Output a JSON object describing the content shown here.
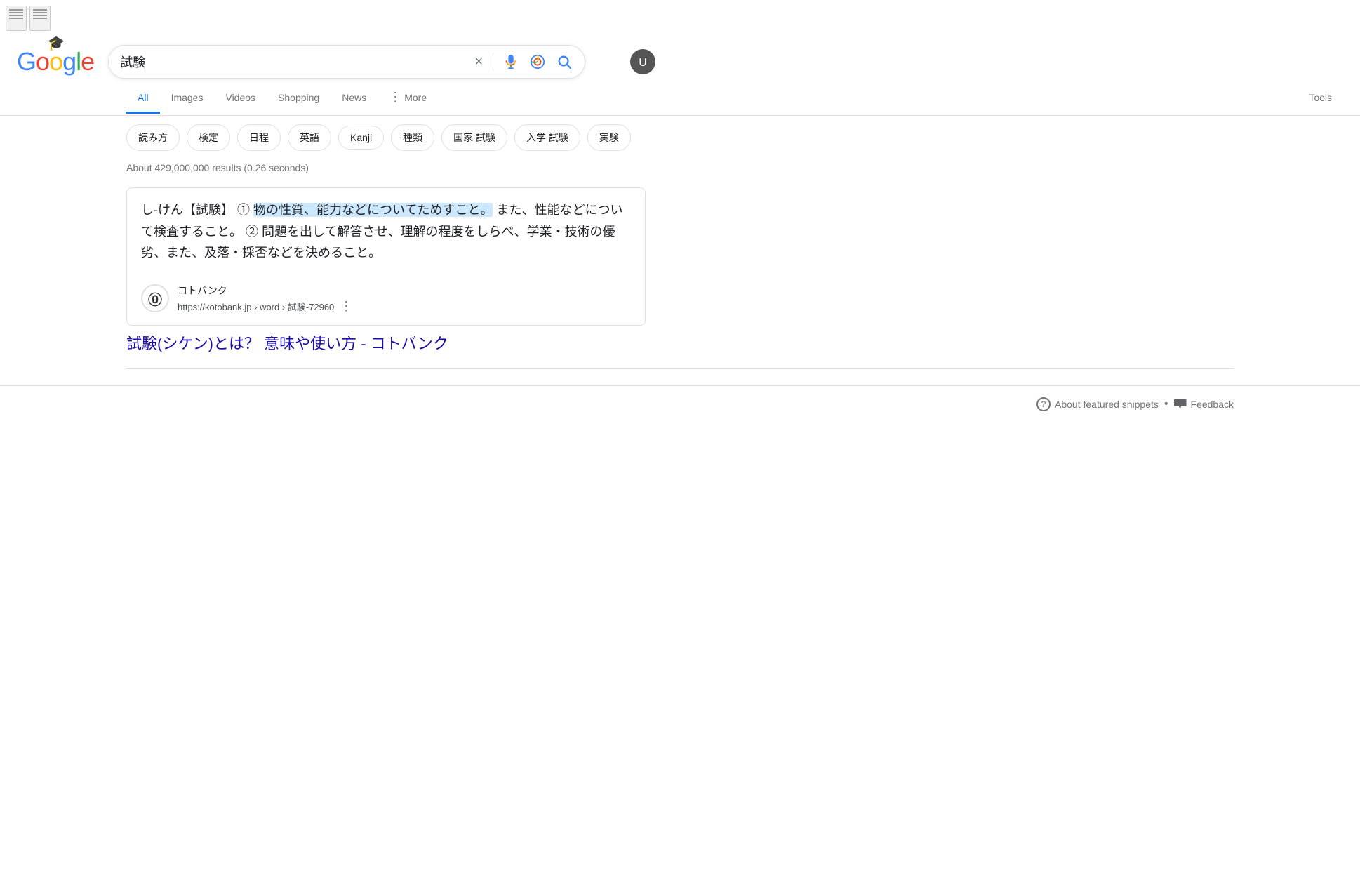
{
  "header": {
    "logo": "Google",
    "search_query": "試験",
    "clear_label": "×",
    "search_button_label": "🔍"
  },
  "nav": {
    "tabs": [
      {
        "id": "all",
        "label": "All",
        "active": true
      },
      {
        "id": "images",
        "label": "Images",
        "active": false
      },
      {
        "id": "videos",
        "label": "Videos",
        "active": false
      },
      {
        "id": "shopping",
        "label": "Shopping",
        "active": false
      },
      {
        "id": "news",
        "label": "News",
        "active": false
      },
      {
        "id": "more",
        "label": "More",
        "active": false,
        "has_dots": true
      },
      {
        "id": "tools",
        "label": "Tools",
        "active": false
      }
    ]
  },
  "chips": {
    "items": [
      {
        "id": "yomikata",
        "label": "読み方"
      },
      {
        "id": "kentei",
        "label": "検定"
      },
      {
        "id": "nittei",
        "label": "日程"
      },
      {
        "id": "eigo",
        "label": "英語"
      },
      {
        "id": "kanji",
        "label": "Kanji"
      },
      {
        "id": "shurui",
        "label": "種類"
      },
      {
        "id": "kokka",
        "label": "国家 試験"
      },
      {
        "id": "nyuugaku",
        "label": "入学 試験"
      },
      {
        "id": "jikken",
        "label": "実験"
      }
    ]
  },
  "results": {
    "count_text": "About 429,000,000 results (0.26 seconds)",
    "featured_snippet": {
      "text_before_highlight": "し‐けん【試験】 ① ",
      "text_highlight": "物の性質、能力などについてためすこと。",
      "text_after": " また、性能などについて検査すること。 ② 問題を出して解答させ、理解の程度をしらべ、学業・技術の優劣、また、及落・採否などを決めること。",
      "source_name": "コトバンク",
      "source_url": "https://kotobank.jp › word › 試験-72960",
      "source_logo_char": "⓪",
      "result_link_text": "試験(シケン)とは？ 意味や使い方 - コトバンク"
    },
    "bottom": {
      "help_text": "About featured snippets",
      "separator": "•",
      "feedback_text": "Feedback"
    }
  }
}
